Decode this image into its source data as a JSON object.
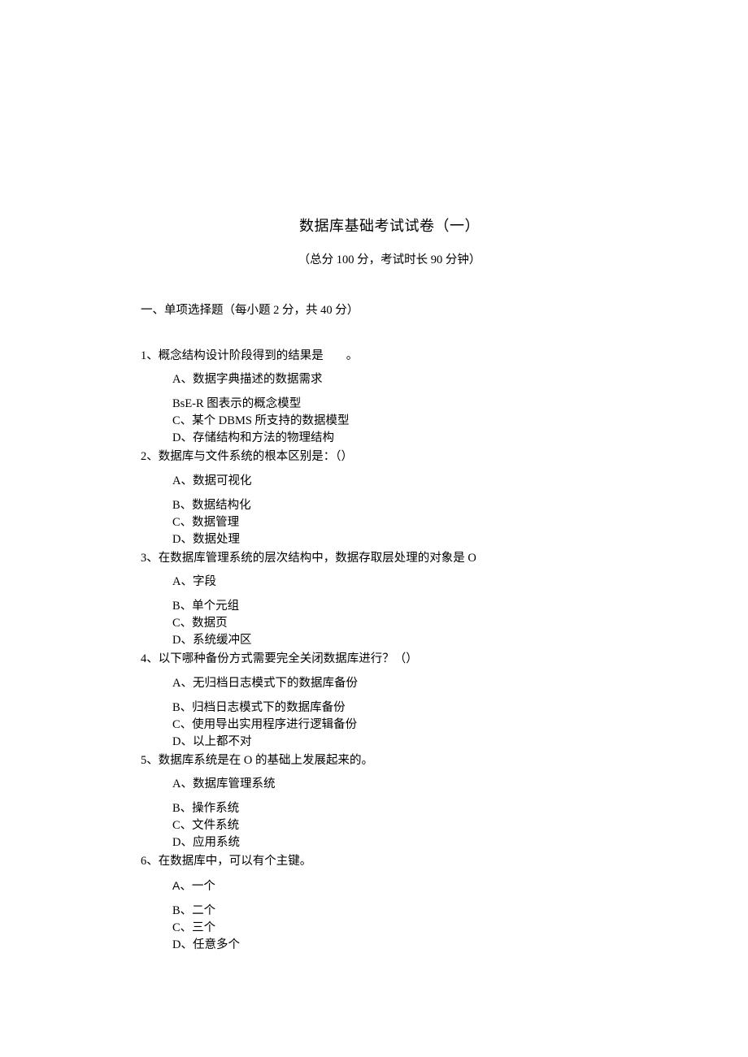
{
  "title": "数据库基础考试试卷（一）",
  "subtitle": "（总分 100 分，考试时长 90 分钟）",
  "section1": "一、单项选择题（每小题 2 分，共 40 分）",
  "q1": {
    "stem_pre": "1、概念结构设计阶段得到的结果是",
    "stem_post": "。",
    "a": "A、数据字典描述的数据需求",
    "b": "BsE-R 图表示的概念模型",
    "c": "C、某个 DBMS 所支持的数据模型",
    "d": "D、存储结构和方法的物理结构"
  },
  "q2": {
    "stem": "2、数据库与文件系统的根本区别是：（）",
    "a": "A、数据可视化",
    "b": "B、数据结构化",
    "c": "C、数据管理",
    "d": "D、数据处理"
  },
  "q3": {
    "stem": "3、在数据库管理系统的层次结构中，数据存取层处理的对象是 O",
    "a": "A、字段",
    "b": "B、单个元组",
    "c": "C、数据页",
    "d": "D、系统缓冲区"
  },
  "q4": {
    "stem": "4、以下哪种备份方式需要完全关闭数据库进行？（）",
    "a": "A、无归档日志模式下的数据库备份",
    "b": "B、归档日志模式下的数据库备份",
    "c": "C、使用导出实用程序进行逻辑备份",
    "d": "D、以上都不对"
  },
  "q5": {
    "stem": "5、数据库系统是在 O 的基础上发展起来的。",
    "a": "A、数据库管理系统",
    "b": "B、操作系统",
    "c": "C、文件系统",
    "d": "D、应用系统"
  },
  "q6": {
    "stem": "6、在数据库中，可以有个主键。",
    "a_letter": "A",
    "a_sep": "、",
    "a_text": "一个",
    "b": "B、二个",
    "c": "C、三个",
    "d": "D、任意多个"
  }
}
